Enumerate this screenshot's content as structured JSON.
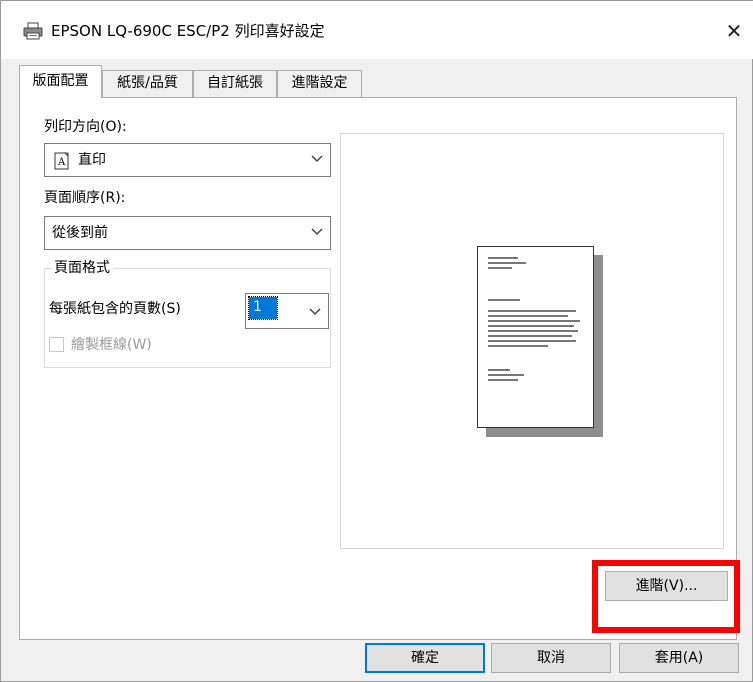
{
  "window": {
    "title": "EPSON LQ-690C ESC/P2 列印喜好設定",
    "close_symbol": "✕"
  },
  "tabs": [
    {
      "label": "版面配置",
      "active": true
    },
    {
      "label": "紙張/品質",
      "active": false
    },
    {
      "label": "自訂紙張",
      "active": false
    },
    {
      "label": "進階設定",
      "active": false
    }
  ],
  "layout": {
    "orientation_label": "列印方向(O):",
    "orientation_value": "直印",
    "orientation_icon_glyph": "A",
    "page_order_label": "頁面順序(R):",
    "page_order_value": "從後到前",
    "page_format_group": "頁面格式",
    "pages_per_sheet_label": "每張紙包含的頁數(S)",
    "pages_per_sheet_value": "1",
    "draw_borders_label": "繪製框線(W)",
    "draw_borders_checked": false
  },
  "buttons": {
    "advanced": "進階(V)...",
    "ok": "確定",
    "cancel": "取消",
    "apply": "套用(A)"
  },
  "colors": {
    "highlight": "#ff0000",
    "accent": "#0078d7"
  }
}
